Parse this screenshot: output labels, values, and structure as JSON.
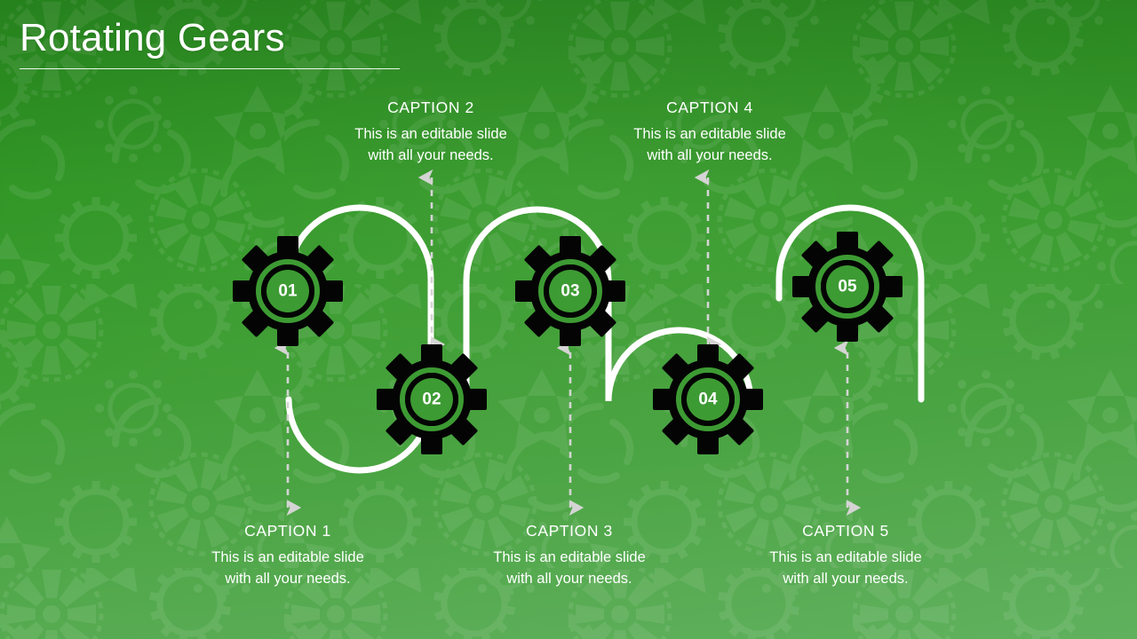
{
  "slide": {
    "title": "Rotating Gears",
    "background_color_top": "#2a9020",
    "background_color_bottom": "#58ad55",
    "accent_color": "#ffffff",
    "gear_color": "#000000",
    "arrow_color": "#d4d4d4",
    "background_pattern": "gear-cog-texture"
  },
  "body_text": "This is an editable slide\nwith all your needs.",
  "steps": [
    {
      "number": "01",
      "caption_title": "CAPTION 1",
      "caption_line1": "This is an editable slide",
      "caption_line2": "with all your needs.",
      "caption_position": "bottom",
      "arrow": "double-headed-vertical"
    },
    {
      "number": "02",
      "caption_title": "CAPTION 2",
      "caption_line1": "This is an editable slide",
      "caption_line2": "with all your needs.",
      "caption_position": "top",
      "arrow": "double-headed-vertical"
    },
    {
      "number": "03",
      "caption_title": "CAPTION 3",
      "caption_line1": "This is an editable slide",
      "caption_line2": "with all your needs.",
      "caption_position": "bottom",
      "arrow": "double-headed-vertical"
    },
    {
      "number": "04",
      "caption_title": "CAPTION 4",
      "caption_line1": "This is an editable slide",
      "caption_line2": "with all your needs.",
      "caption_position": "top",
      "arrow": "double-headed-vertical"
    },
    {
      "number": "05",
      "caption_title": "CAPTION 5",
      "caption_line1": "This is an editable slide",
      "caption_line2": "with all your needs.",
      "caption_position": "bottom",
      "arrow": "double-headed-vertical"
    }
  ]
}
